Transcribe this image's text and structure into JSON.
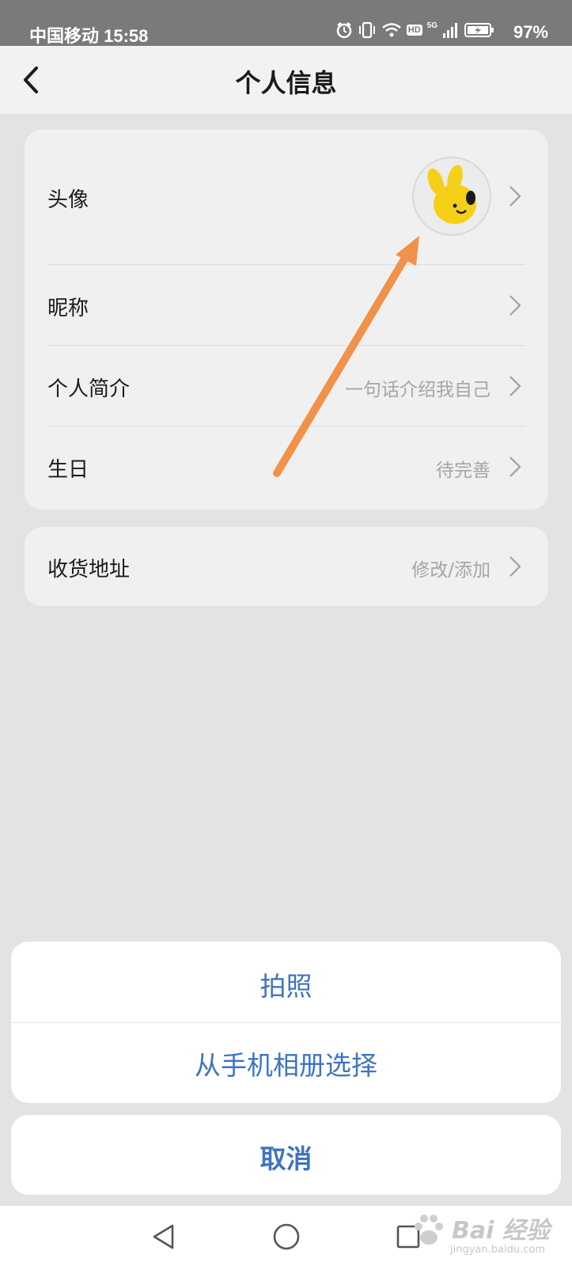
{
  "status_bar": {
    "carrier_time": "中国移动 15:58",
    "network": "5G",
    "hd": "HD",
    "battery": "97%"
  },
  "header": {
    "title": "个人信息"
  },
  "profile": {
    "rows": [
      {
        "label": "头像",
        "value": ""
      },
      {
        "label": "昵称",
        "value": ""
      },
      {
        "label": "个人简介",
        "value": "一句话介绍我自己"
      },
      {
        "label": "生日",
        "value": "待完善"
      }
    ],
    "address": {
      "label": "收货地址",
      "value": "修改/添加"
    }
  },
  "action_sheet": {
    "take_photo": "拍照",
    "choose_album": "从手机相册选择",
    "cancel": "取消"
  },
  "watermark": {
    "text": "Bai 经验",
    "sub": "jingyan.baidu.com"
  },
  "colors": {
    "accent": "#3e74c0",
    "arrow": "#f0924a",
    "avatar_yellow": "#f5d018"
  }
}
